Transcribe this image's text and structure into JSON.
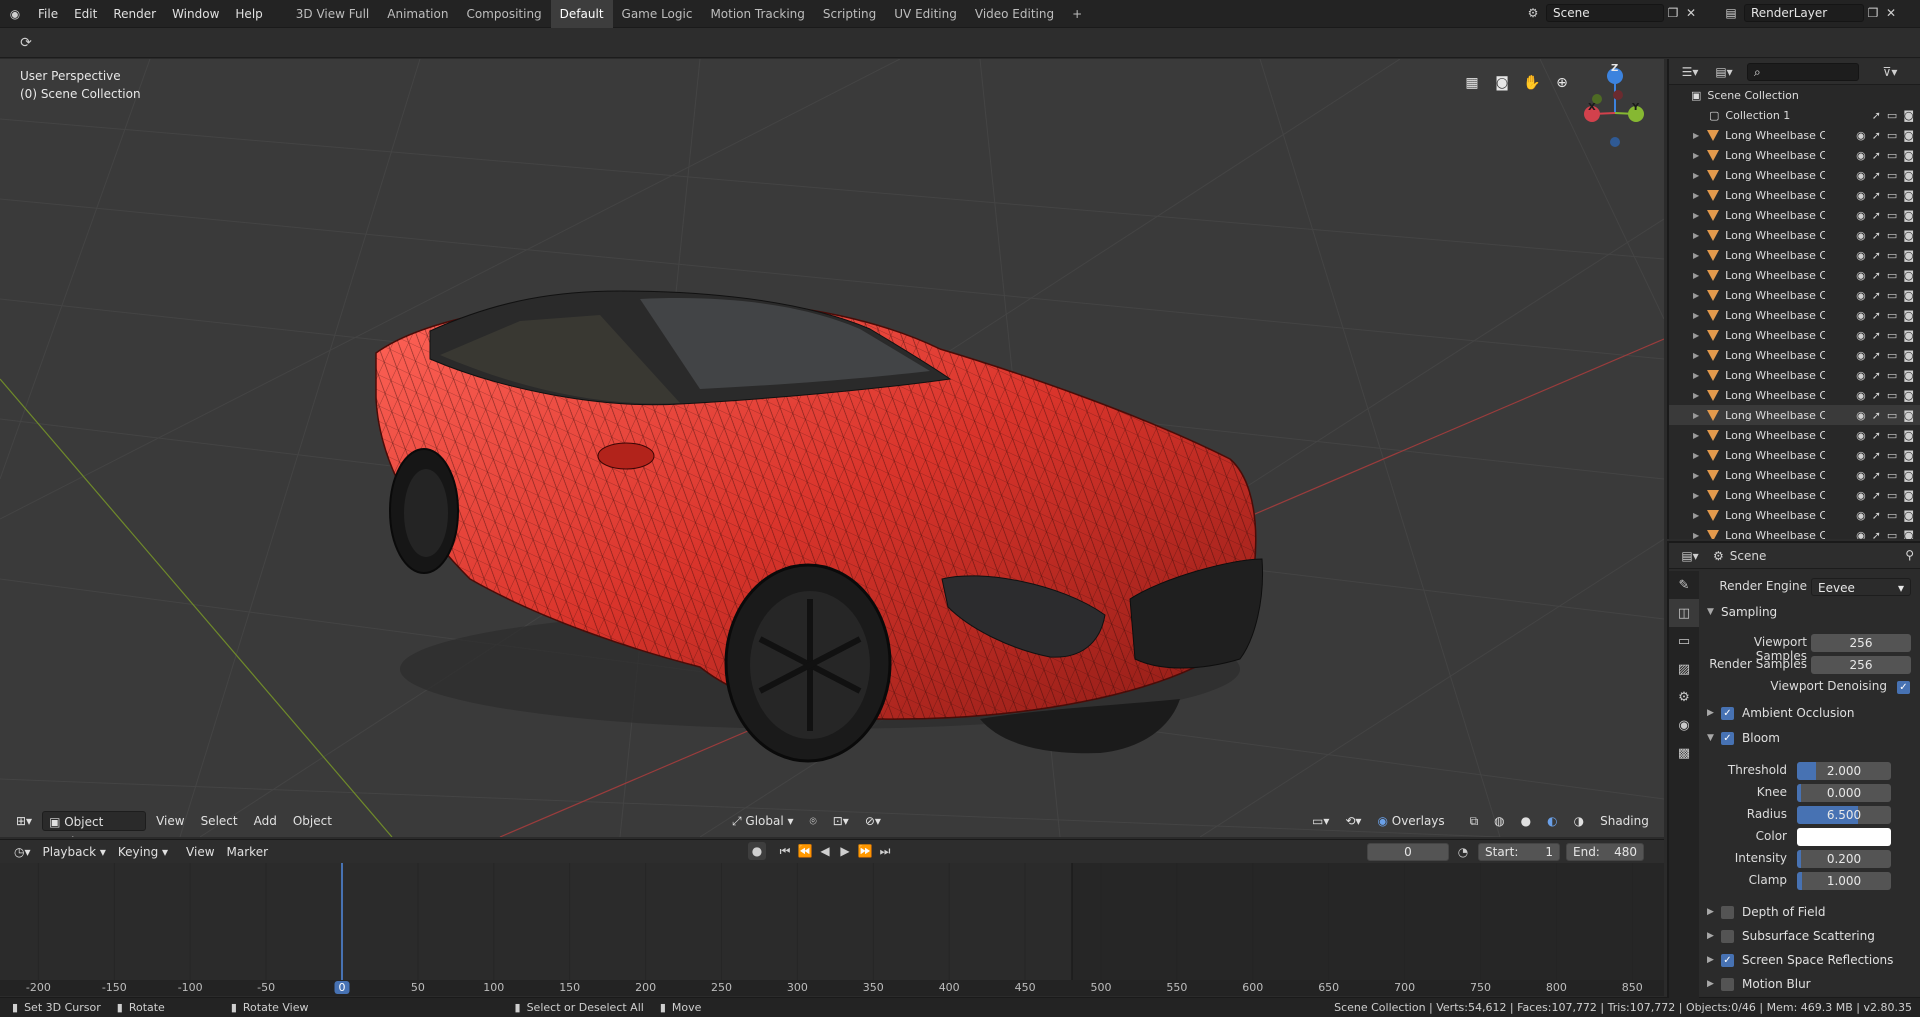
{
  "topbar": {
    "menus": [
      "File",
      "Edit",
      "Render",
      "Window",
      "Help"
    ],
    "workspaces": [
      "3D View Full",
      "Animation",
      "Compositing",
      "Default",
      "Game Logic",
      "Motion Tracking",
      "Scripting",
      "UV Editing",
      "Video Editing"
    ],
    "active_workspace": "Default",
    "add_tab": "+",
    "scene_name": "Scene",
    "view_layer": "RenderLayer"
  },
  "viewport": {
    "perspective_label": "User Perspective",
    "collection_label": "(0) Scene Collection",
    "mode": "Object Mode",
    "menus": [
      "View",
      "Select",
      "Add",
      "Object"
    ],
    "orientation": "Global",
    "overlays": "Overlays",
    "shading": "Shading",
    "gizmo_axes": {
      "x": "X",
      "y": "Y",
      "z": "Z"
    }
  },
  "timeline": {
    "menus": [
      "Playback",
      "Keying",
      "View",
      "Marker"
    ],
    "current_frame": "0",
    "start_label": "Start:",
    "start": "1",
    "end_label": "End:",
    "end": "480",
    "ticks": [
      "-200",
      "-150",
      "-100",
      "-50",
      "0",
      "50",
      "100",
      "150",
      "200",
      "250",
      "300",
      "350",
      "400",
      "450",
      "500",
      "550",
      "600",
      "650",
      "700",
      "750",
      "800",
      "850"
    ]
  },
  "statusbar": {
    "hints": [
      "Set 3D Cursor",
      "Rotate",
      "Rotate View",
      "Select or Deselect All",
      "Move"
    ],
    "stats": "Scene Collection | Verts:54,612 | Faces:107,772 | Tris:107,772 | Objects:0/46 | Mem: 469.3 MB | v2.80.35"
  },
  "outliner": {
    "root": "Scene Collection",
    "collection": "Collection 1",
    "items": [
      "Long Wheelbase Car",
      "Long Wheelbase Car",
      "Long Wheelbase Car",
      "Long Wheelbase Car",
      "Long Wheelbase Car",
      "Long Wheelbase Car",
      "Long Wheelbase Car",
      "Long Wheelbase Car",
      "Long Wheelbase Car",
      "Long Wheelbase Car",
      "Long Wheelbase Car",
      "Long Wheelbase Car",
      "Long Wheelbase Car",
      "Long Wheelbase Car",
      "Long Wheelbase Car",
      "Long Wheelbase Car",
      "Long Wheelbase Car",
      "Long Wheelbase Car",
      "Long Wheelbase Car",
      "Long Wheelbase Car",
      "Long Wheelbase Car"
    ],
    "selected_index": 14
  },
  "properties": {
    "context": "Scene",
    "render_engine_label": "Render Engine",
    "render_engine": "Eevee",
    "sampling": {
      "title": "Sampling",
      "viewport_samples_label": "Viewport Samples",
      "viewport_samples": "256",
      "render_samples_label": "Render Samples",
      "render_samples": "256",
      "denoise_label": "Viewport Denoising"
    },
    "ambient_occlusion": "Ambient Occlusion",
    "bloom": {
      "title": "Bloom",
      "threshold_label": "Threshold",
      "threshold": "2.000",
      "threshold_frac": 0.2,
      "knee_label": "Knee",
      "knee": "0.000",
      "knee_frac": 0.0,
      "radius_label": "Radius",
      "radius": "6.500",
      "radius_frac": 0.65,
      "color_label": "Color",
      "intensity_label": "Intensity",
      "intensity": "0.200",
      "intensity_frac": 0.0,
      "clamp_label": "Clamp",
      "clamp": "1.000",
      "clamp_frac": 0.05
    },
    "panels": {
      "depth_of_field": "Depth of Field",
      "subsurface": "Subsurface Scattering",
      "ssr": "Screen Space Reflections",
      "motion_blur": "Motion Blur"
    }
  },
  "colors": {
    "accent": "#4772b3",
    "car_body": "#d9342b",
    "x_axis": "#d2414c",
    "y_axis": "#86b832",
    "z_axis": "#3c83de",
    "outliner_icon": "#e49a4c"
  }
}
